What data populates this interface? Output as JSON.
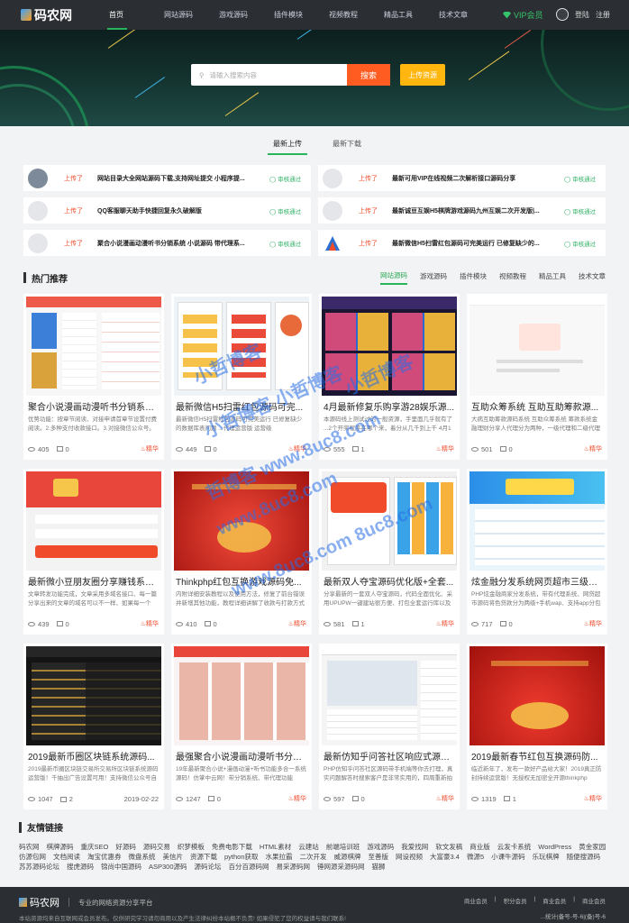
{
  "header": {
    "logo": "码农网",
    "nav": [
      "首页",
      "网站源码",
      "游戏源码",
      "插件模块",
      "视频教程",
      "精品工具",
      "技术文章"
    ],
    "vip": "VIP会员",
    "login": "登陆",
    "register": "注册"
  },
  "search": {
    "placeholder": "请输入搜索内容",
    "button": "搜索",
    "upload": "上传资源"
  },
  "upload_tabs": [
    "最新上传",
    "最新下载"
  ],
  "updates": [
    {
      "tag": "上传了",
      "title": "网站目录大全网站源码下载,支持网址提交 小程序提...",
      "status": "审核通过"
    },
    {
      "tag": "上传了",
      "title": "最新可用VIP在线视频二次解析接口源码分享",
      "status": "审核通过"
    },
    {
      "tag": "上传了",
      "title": "QQ客服聊天助手快捷回复永久破解版",
      "status": "审核通过"
    },
    {
      "tag": "上传了",
      "title": "最新诚豆互娱H5棋牌游戏源码九州互娱二次开发版|...",
      "status": "审核通过"
    },
    {
      "tag": "上传了",
      "title": "聚合小说漫画动漫听书分销系统 小说源码 带代理系...",
      "status": "审核通过"
    },
    {
      "tag": "上传了",
      "title": "最新微信H5扫雷红包源码可完美运行 已修复缺少的...",
      "status": "审核通过"
    }
  ],
  "hot": {
    "title": "热门推荐",
    "tabs": [
      "网站源码",
      "游戏源码",
      "插件模块",
      "视频教程",
      "精品工具",
      "技术文章"
    ]
  },
  "cards": [
    {
      "title": "聚合小说漫画动漫听书分销系统...",
      "desc": "优势功能：按章节阅读、对接申请首章节设置付费阅读。2.多种支付收款接口。3.对接微信公众号。",
      "views": "405",
      "comments": "0",
      "badge": "精华"
    },
    {
      "title": "最新微信H5扫雷红包源码可完...",
      "desc": "最新微信H5扫雷红包源码可完美运行 已修复缺少的数据库表问题 ...代理运营版 运营级",
      "views": "449",
      "comments": "0",
      "badge": "精华"
    },
    {
      "title": "4月最新修复乐购享游28娱乐源...",
      "desc": "本源码线上测试过的一般资源，手里面几乎就有了 ...2个开奖程序在哪个来，着分从几千到上千 4月1日",
      "views": "555",
      "comments": "1",
      "badge": "精华"
    },
    {
      "title": "互助众筹系统 互助互助筹款源...",
      "desc": "大病互助筹款源码系统 互助众筹系统 筹款系统金融理财分享人代理分为两种，一级代理和二级代理 2千",
      "views": "501",
      "comments": "0",
      "badge": "精华"
    },
    {
      "title": "最新微小豆朋友圈分享赚钱系统...",
      "desc": "文章转发功能完成，文章采用多域名接口、每一篇分享出来的文章的域名可以不一样、如果每一个",
      "views": "439",
      "comments": "0",
      "badge": "精华"
    },
    {
      "title": "Thinkphp红包互换游戏源码免...",
      "desc": "内附详细安装教程以及使用方法，修复了前台错误并新增其他功能，教程详细讲解了收款与打款方式",
      "views": "410",
      "comments": "0",
      "badge": "精华"
    },
    {
      "title": "最新双人夺宝源码优化版+全套...",
      "desc": "分享最新的一套双人夺宝源码，代码全面优化、采用UPUPW一键建站很方便、打包全套运行库以及",
      "views": "581",
      "comments": "1",
      "badge": "精华"
    },
    {
      "title": "炫金融分发系统网页超市三级分...",
      "desc": "PHP炫金融商家分发系统，带有代理系统、网贷超市源码将色贷款分为两级+手机wap、支持app分包",
      "views": "717",
      "comments": "0",
      "badge": "精华"
    },
    {
      "title": "2019最新币圈区块链系统源码...",
      "desc": "2019最新币圈区块链交易所交易所区块链系统源码运营版！千抽出广告设置可用！支持微信公众号自动判断",
      "views": "1047",
      "comments": "2",
      "date": "2019-02-22"
    },
    {
      "title": "最强聚合小说漫画动漫听书分销...",
      "desc": "19年最新聚合小说+漫画动漫+听书功能多合一系统源码！仿掌中云网！带分销系统、带代理功能",
      "views": "1247",
      "comments": "0",
      "badge": "精华"
    },
    {
      "title": "最新仿知乎问答社区响应式源码...",
      "desc": "PHP仿知乎问答社区源码带手机端等你去打理，真实问题解答时搜索客户是非常实用的，四周重新拍到设置",
      "views": "597",
      "comments": "0",
      "badge": "精华"
    },
    {
      "title": "2019最新春节红包互换源码防...",
      "desc": "临近新年了，发布一款好产品给大家！2019真正防封持续运营版！无授权无加密全开源thinkphp",
      "views": "1319",
      "comments": "1",
      "badge": "精华"
    }
  ],
  "links": {
    "title": "友情链接",
    "items": [
      "码农网",
      "棋牌源码",
      "重庆SEO",
      "好源码",
      "源码交易",
      "织梦模板",
      "免费电影下载",
      "HTML素材",
      "云建站",
      "前端培训班",
      "游戏源码",
      "我爱找网",
      "软文发稿",
      "商业版",
      "云发卡系统",
      "WordPress",
      "黄金家园",
      "仿源包网",
      "文档阅读",
      "淘宝优惠券",
      "微盘系统",
      "美信片",
      "资源下载",
      "python获取",
      "水果拉霸",
      "二次开发",
      "威源棋牌",
      "至善版",
      "网设视频",
      "大富豪3.4",
      "微源5",
      "小课牛源码",
      "乐玩棋牌",
      "随便搜源码",
      "苏苏源码论坛",
      "搜虎源码",
      "锦尚中国源码",
      "ASP300源码",
      "源码论坛",
      "百分百源码网",
      "易采源码网",
      "锤网源采源码网",
      "猫狮"
    ]
  },
  "footer": {
    "logo": "码农网",
    "slogan": "专业的网络资源分享平台",
    "links": [
      "商业会员",
      "积分会员",
      "商业会员",
      "商业会员"
    ],
    "notice": "本站资源均来自互联网或会员发布。仅供研究学习请勿商用以及产生法律纠纷本站概不负责! 如果侵犯了您的权益请与我们联系!",
    "icp": "...统计|备号-号-6|(备)号-6"
  },
  "watermarks": [
    "小哲博客",
    "小哲博客 小哲博客",
    "哲博客 www.8uc8.com",
    "www.8uc8.com",
    "www.8uc8.com 8uc8.com",
    "小哲博客"
  ]
}
